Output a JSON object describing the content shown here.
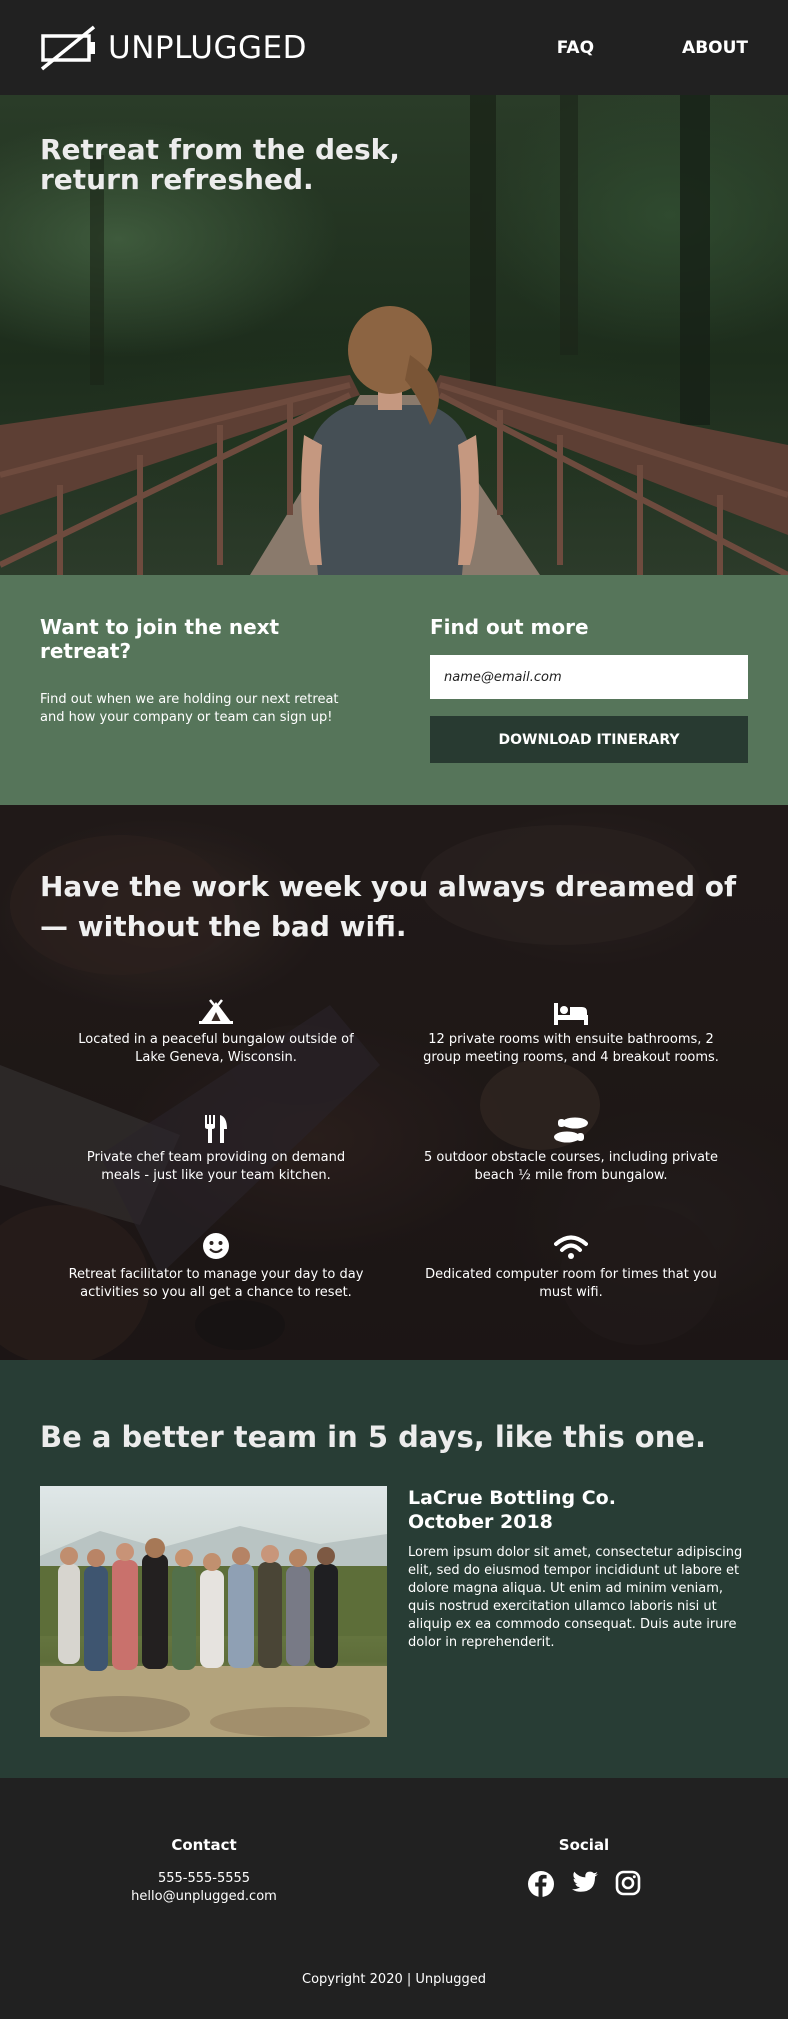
{
  "header": {
    "brand": "UNPLUGGED",
    "nav": [
      {
        "label": "FAQ"
      },
      {
        "label": "ABOUT"
      }
    ]
  },
  "hero": {
    "title": "Retreat from the desk, return refreshed."
  },
  "signup": {
    "heading": "Want to join the next retreat?",
    "text": "Find out when we are holding our next retreat and how your company or team can sign up!",
    "form_heading": "Find out more",
    "email_placeholder": "name@email.com",
    "button_label": "DOWNLOAD ITINERARY"
  },
  "features": {
    "title": "Have the work week you always dreamed of — without the bad wifi.",
    "items": [
      {
        "icon": "campground-icon",
        "text": "Located in a peaceful bungalow outside of Lake Geneva, Wisconsin."
      },
      {
        "icon": "bed-icon",
        "text": "12 private rooms with ensuite bathrooms, 2 group meeting rooms, and 4 breakout rooms."
      },
      {
        "icon": "utensils-icon",
        "text": "Private chef team providing on demand meals - just like your team kitchen."
      },
      {
        "icon": "shoe-prints-icon",
        "text": "5 outdoor obstacle courses, including private beach ½ mile from bungalow."
      },
      {
        "icon": "smile-icon",
        "text": "Retreat facilitator to manage your day to day activities so you all get a chance to reset."
      },
      {
        "icon": "wifi-icon",
        "text": "Dedicated computer room for times that you must wifi."
      }
    ]
  },
  "team": {
    "title": "Be a better team in 5 days, like this one.",
    "company": "LaCrue Bottling Co.",
    "date": "October 2018",
    "text": "Lorem ipsum dolor sit amet, consectetur adipiscing elit, sed do eiusmod tempor incididunt ut labore et dolore magna aliqua. Ut enim ad minim veniam, quis nostrud exercitation ullamco laboris nisi ut aliquip ex ea commodo consequat. Duis aute irure dolor in reprehenderit."
  },
  "footer": {
    "contact_heading": "Contact",
    "phone": "555-555-5555",
    "email": "hello@unplugged.com",
    "social_heading": "Social",
    "social": [
      "facebook-icon",
      "twitter-icon",
      "instagram-icon"
    ],
    "copyright": "Copyright 2020 | Unplugged"
  },
  "colors": {
    "header_bg": "#212121",
    "signup_bg": "#56755a",
    "button_bg": "#283a31",
    "team_bg": "#283d35"
  }
}
